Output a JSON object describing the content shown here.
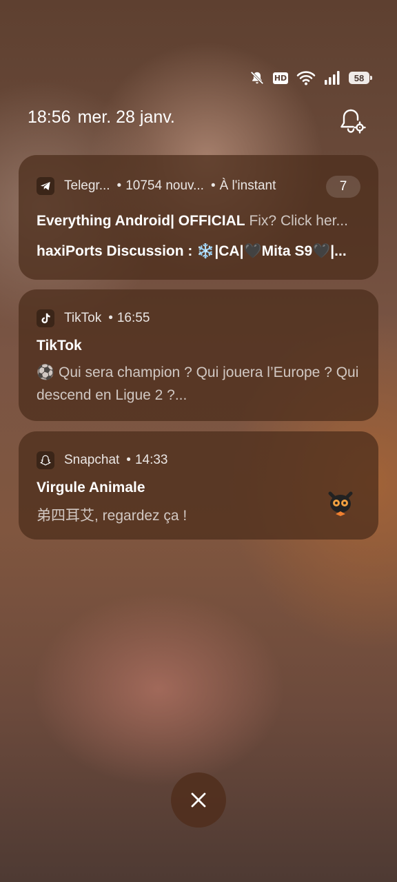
{
  "status_bar": {
    "icons": [
      "mute-bell-icon",
      "hd-icon",
      "wifi-icon",
      "signal-icon",
      "battery-icon"
    ],
    "hd_label": "HD",
    "battery_level": "58"
  },
  "header": {
    "time": "18:56",
    "date": "mer. 28 janv."
  },
  "notifications": [
    {
      "app": "Telegr...",
      "meta": "10754 nouv...",
      "time": "À l'instant",
      "count": "7",
      "line1_title": "Everything Android| OFFICIAL",
      "line1_text": "Fix? Click her...",
      "line2": "haxiPorts Discussion : ❄️|CA|🖤Mita S9🖤|..."
    },
    {
      "app": "TikTok",
      "time": "16:55",
      "title": "TikTok",
      "body": "⚽ Qui sera champion ? Qui jouera l’Europe ? Qui descend en Ligue 2 ?..."
    },
    {
      "app": "Snapchat",
      "time": "14:33",
      "title": "Virgule Animale",
      "body": "弟四耳艾, regardez ça !"
    }
  ],
  "colors": {
    "card_bg": "#4b2c1a",
    "accent_text": "#ffffff"
  }
}
